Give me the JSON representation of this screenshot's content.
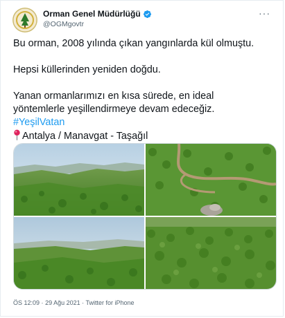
{
  "account": {
    "name": "Orman Genel Müdürlüğü",
    "handle": "@OGMgovtr",
    "verified": true,
    "avatar_icon": "ogm-logo-icon"
  },
  "tweet": {
    "line1": "Bu orman, 2008 yılında çıkan yangınlarda kül olmuştu.",
    "line2": "Hepsi küllerinden yeniden doğdu.",
    "line3a": "Yanan ormanlarımızı en kısa sürede, en ideal",
    "line3b": "yöntemlerle yeşillendirmeye devam edeceğiz.",
    "hashtag": "#YeşilVatan",
    "location": "Antalya / Manavgat - Taşağıl",
    "pin_icon": "round-pushpin-icon"
  },
  "media": {
    "photos": [
      "aerial forest photo 1",
      "aerial forest road photo 2",
      "aerial forest photo 3",
      "aerial forest photo 4"
    ]
  },
  "meta": {
    "time": "ÖS 12:09",
    "date": "29 Ağu 2021",
    "source": "Twitter for iPhone",
    "separator": "·"
  },
  "colors": {
    "link": "#1d9bf0",
    "verified": "#1d9bf0",
    "secondary_text": "#536471",
    "forest": "#4f8a2c"
  }
}
